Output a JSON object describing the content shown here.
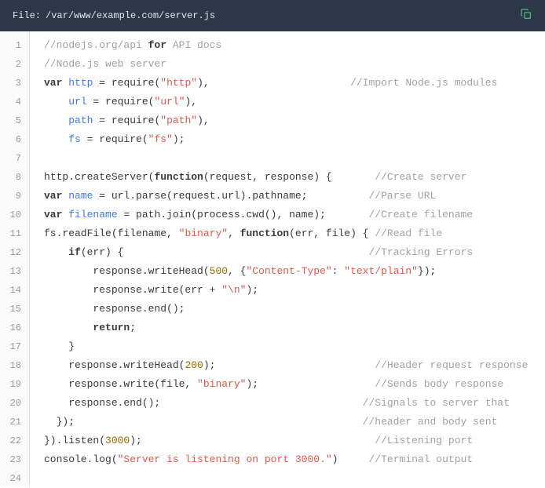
{
  "header": {
    "file_label": "File:",
    "file_path": "/var/www/example.com/server.js"
  },
  "code": {
    "lines": [
      {
        "n": 1,
        "tokens": [
          {
            "t": "//nodejs.org/api ",
            "c": "c"
          },
          {
            "t": "for",
            "c": "k"
          },
          {
            "t": " API docs",
            "c": "c"
          }
        ]
      },
      {
        "n": 2,
        "tokens": [
          {
            "t": "//Node.js web server",
            "c": "c"
          }
        ]
      },
      {
        "n": 3,
        "tokens": [
          {
            "t": "var ",
            "c": "k"
          },
          {
            "t": "http",
            "c": "d"
          },
          {
            "t": " = require(",
            "c": "p"
          },
          {
            "t": "\"http\"",
            "c": "s"
          },
          {
            "t": "),                       ",
            "c": "p"
          },
          {
            "t": "//Import Node.js modules",
            "c": "c"
          }
        ]
      },
      {
        "n": 4,
        "tokens": [
          {
            "t": "    ",
            "c": "p"
          },
          {
            "t": "url",
            "c": "d"
          },
          {
            "t": " = require(",
            "c": "p"
          },
          {
            "t": "\"url\"",
            "c": "s"
          },
          {
            "t": "),",
            "c": "p"
          }
        ]
      },
      {
        "n": 5,
        "tokens": [
          {
            "t": "    ",
            "c": "p"
          },
          {
            "t": "path",
            "c": "d"
          },
          {
            "t": " = require(",
            "c": "p"
          },
          {
            "t": "\"path\"",
            "c": "s"
          },
          {
            "t": "),",
            "c": "p"
          }
        ]
      },
      {
        "n": 6,
        "tokens": [
          {
            "t": "    ",
            "c": "p"
          },
          {
            "t": "fs",
            "c": "d"
          },
          {
            "t": " = require(",
            "c": "p"
          },
          {
            "t": "\"fs\"",
            "c": "s"
          },
          {
            "t": ");",
            "c": "p"
          }
        ]
      },
      {
        "n": 7,
        "tokens": []
      },
      {
        "n": 8,
        "tokens": [
          {
            "t": "http.createServer(",
            "c": "p"
          },
          {
            "t": "function",
            "c": "k"
          },
          {
            "t": "(request, response) {       ",
            "c": "p"
          },
          {
            "t": "//Create server",
            "c": "c"
          }
        ]
      },
      {
        "n": 9,
        "tokens": [
          {
            "t": "var ",
            "c": "k"
          },
          {
            "t": "name",
            "c": "d"
          },
          {
            "t": " = url.parse(request.url).pathname;          ",
            "c": "p"
          },
          {
            "t": "//Parse URL",
            "c": "c"
          }
        ]
      },
      {
        "n": 10,
        "tokens": [
          {
            "t": "var ",
            "c": "k"
          },
          {
            "t": "filename",
            "c": "d"
          },
          {
            "t": " = path.join(process.cwd(), name);       ",
            "c": "p"
          },
          {
            "t": "//Create filename",
            "c": "c"
          }
        ]
      },
      {
        "n": 11,
        "tokens": [
          {
            "t": "fs.readFile(filename, ",
            "c": "p"
          },
          {
            "t": "\"binary\"",
            "c": "s"
          },
          {
            "t": ", ",
            "c": "p"
          },
          {
            "t": "function",
            "c": "k"
          },
          {
            "t": "(err, file) { ",
            "c": "p"
          },
          {
            "t": "//Read file",
            "c": "c"
          }
        ]
      },
      {
        "n": 12,
        "tokens": [
          {
            "t": "    ",
            "c": "p"
          },
          {
            "t": "if",
            "c": "k"
          },
          {
            "t": "(err) {                                        ",
            "c": "p"
          },
          {
            "t": "//Tracking Errors",
            "c": "c"
          }
        ]
      },
      {
        "n": 13,
        "tokens": [
          {
            "t": "        response.writeHead(",
            "c": "p"
          },
          {
            "t": "500",
            "c": "n"
          },
          {
            "t": ", {",
            "c": "p"
          },
          {
            "t": "\"Content-Type\"",
            "c": "s"
          },
          {
            "t": ": ",
            "c": "p"
          },
          {
            "t": "\"text/plain\"",
            "c": "s"
          },
          {
            "t": "});",
            "c": "p"
          }
        ]
      },
      {
        "n": 14,
        "tokens": [
          {
            "t": "        response.write(err + ",
            "c": "p"
          },
          {
            "t": "\"\\n\"",
            "c": "s"
          },
          {
            "t": ");",
            "c": "p"
          }
        ]
      },
      {
        "n": 15,
        "tokens": [
          {
            "t": "        response.end();",
            "c": "p"
          }
        ]
      },
      {
        "n": 16,
        "tokens": [
          {
            "t": "        ",
            "c": "p"
          },
          {
            "t": "return",
            "c": "k"
          },
          {
            "t": ";",
            "c": "p"
          }
        ]
      },
      {
        "n": 17,
        "tokens": [
          {
            "t": "    }",
            "c": "p"
          }
        ]
      },
      {
        "n": 18,
        "tokens": [
          {
            "t": "    response.writeHead(",
            "c": "p"
          },
          {
            "t": "200",
            "c": "n"
          },
          {
            "t": ");                          ",
            "c": "p"
          },
          {
            "t": "//Header request response",
            "c": "c"
          }
        ]
      },
      {
        "n": 19,
        "tokens": [
          {
            "t": "    response.write(file, ",
            "c": "p"
          },
          {
            "t": "\"binary\"",
            "c": "s"
          },
          {
            "t": ");                   ",
            "c": "p"
          },
          {
            "t": "//Sends body response",
            "c": "c"
          }
        ]
      },
      {
        "n": 20,
        "tokens": [
          {
            "t": "    response.end();                                 ",
            "c": "p"
          },
          {
            "t": "//Signals to server that",
            "c": "c"
          }
        ]
      },
      {
        "n": 21,
        "tokens": [
          {
            "t": "  });                                               ",
            "c": "p"
          },
          {
            "t": "//header and body sent",
            "c": "c"
          }
        ]
      },
      {
        "n": 22,
        "tokens": [
          {
            "t": "}).listen(",
            "c": "p"
          },
          {
            "t": "3000",
            "c": "n"
          },
          {
            "t": ");                                      ",
            "c": "p"
          },
          {
            "t": "//Listening port",
            "c": "c"
          }
        ]
      },
      {
        "n": 23,
        "tokens": [
          {
            "t": "console.log(",
            "c": "p"
          },
          {
            "t": "\"Server is listening on port 3000.\"",
            "c": "s"
          },
          {
            "t": ")     ",
            "c": "p"
          },
          {
            "t": "//Terminal output",
            "c": "c"
          }
        ]
      },
      {
        "n": 24,
        "tokens": []
      }
    ]
  }
}
